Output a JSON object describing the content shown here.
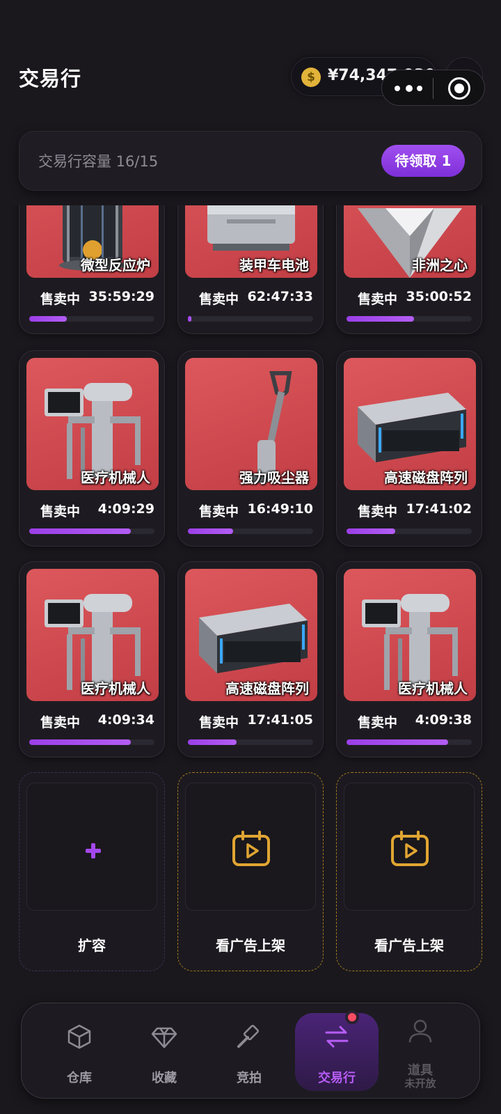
{
  "header": {
    "title": "交易行",
    "balance": "¥74,347,030",
    "coin_symbol": "$",
    "plus": "+"
  },
  "capacity": {
    "label": "交易行容量 16/15",
    "claim_button": "待领取 1"
  },
  "listings": [
    {
      "name": "微型反应炉",
      "status": "售卖中",
      "time_left": "35:59:29",
      "progress": 0.3
    },
    {
      "name": "装甲车电池",
      "status": "售卖中",
      "time_left": "62:47:33",
      "progress": 0.03
    },
    {
      "name": "非洲之心",
      "status": "售卖中",
      "time_left": "35:00:52",
      "progress": 0.54
    },
    {
      "name": "医疗机械人",
      "status": "售卖中",
      "time_left": "4:09:29",
      "progress": 0.81
    },
    {
      "name": "强力吸尘器",
      "status": "售卖中",
      "time_left": "16:49:10",
      "progress": 0.36
    },
    {
      "name": "高速磁盘阵列",
      "status": "售卖中",
      "time_left": "17:41:02",
      "progress": 0.39
    },
    {
      "name": "医疗机械人",
      "status": "售卖中",
      "time_left": "4:09:34",
      "progress": 0.81
    },
    {
      "name": "高速磁盘阵列",
      "status": "售卖中",
      "time_left": "17:41:05",
      "progress": 0.39
    },
    {
      "name": "医疗机械人",
      "status": "售卖中",
      "time_left": "4:09:38",
      "progress": 0.81
    }
  ],
  "slots": {
    "expand": "扩容",
    "watch_ad_1": "看广告上架",
    "watch_ad_2": "看广告上架"
  },
  "nav": {
    "warehouse": "仓库",
    "collection": "收藏",
    "auction": "竞拍",
    "trading": "交易行",
    "items": "道具",
    "items_sub": "未开放"
  },
  "colors": {
    "accent": "#a448ee",
    "card_bg": "#d9494f",
    "ad_gold": "#e0a532",
    "badge": "#ff4c63"
  }
}
